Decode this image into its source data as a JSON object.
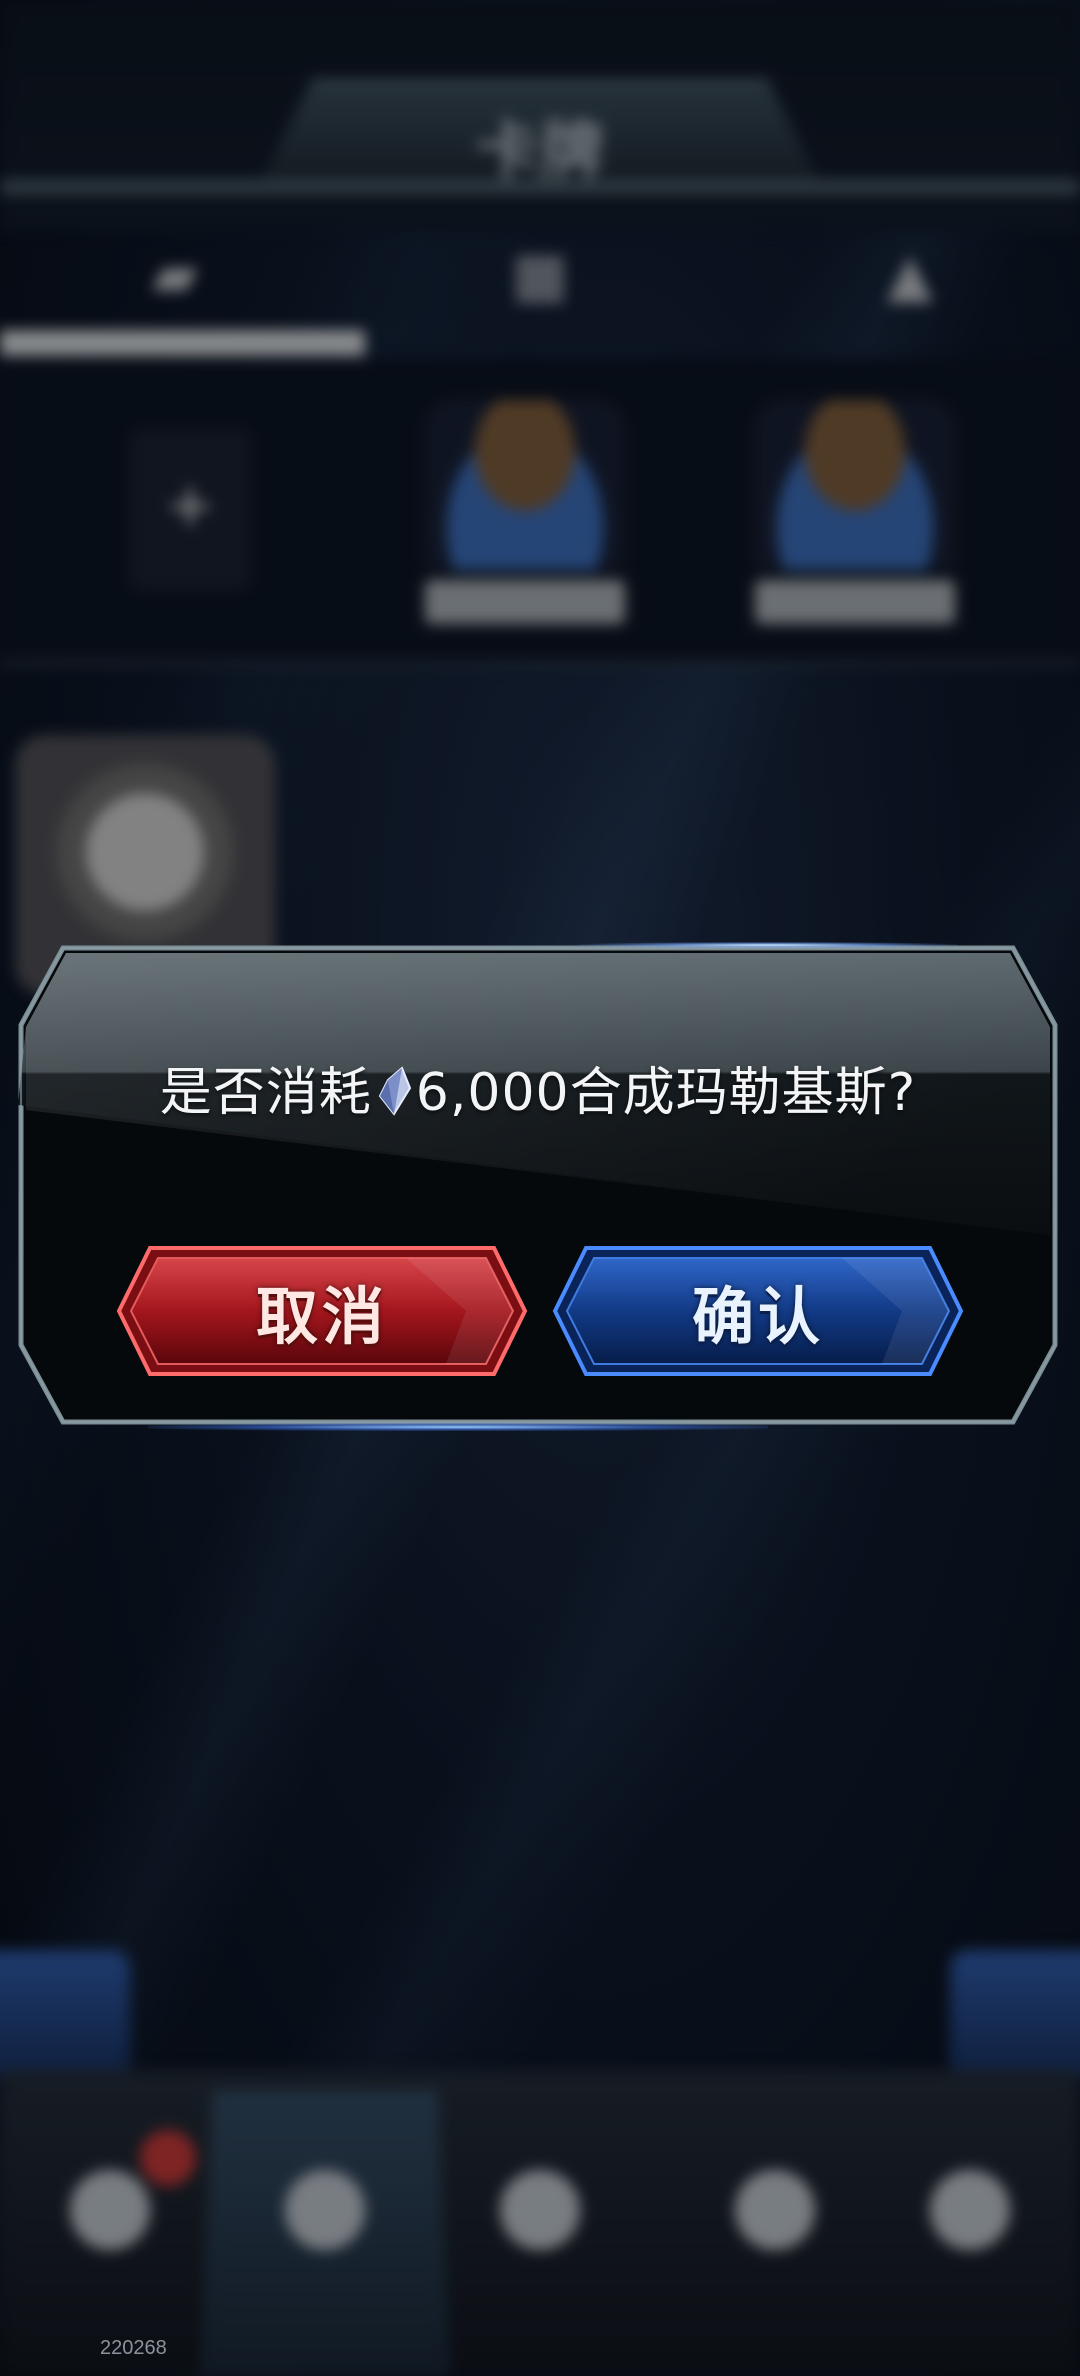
{
  "background": {
    "header_title": "卡牌"
  },
  "dialog": {
    "message_prefix": "是否消耗",
    "currency_icon": "crystal-gem-icon",
    "amount": "6,000",
    "message_suffix": "合成玛勒基斯?",
    "cancel_label": "取消",
    "confirm_label": "确认"
  },
  "footer": {
    "build_id": "220268"
  },
  "colors": {
    "cancel": "#b8242a",
    "confirm": "#1d4aa8",
    "dialog_frame": "#6f858e"
  }
}
